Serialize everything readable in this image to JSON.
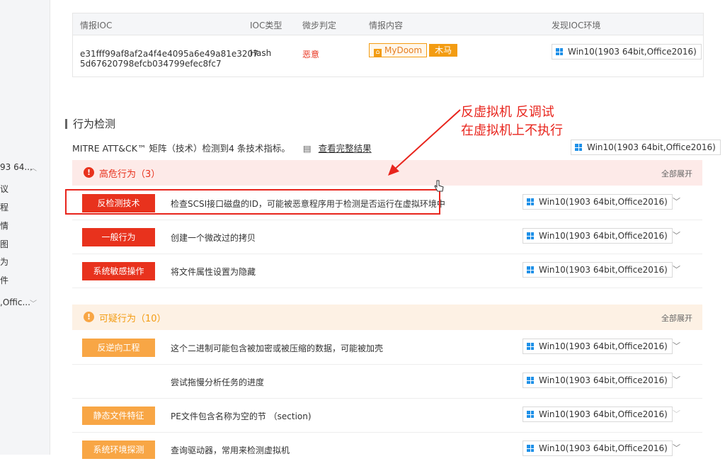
{
  "left_sidebar": {
    "items": [
      "93 64...",
      "议",
      "程",
      "情",
      "图",
      "为",
      "件",
      ",Offic..."
    ]
  },
  "intel_ioc": {
    "headers": [
      "情报IOC",
      "IOC类型",
      "微步判定",
      "情报内容",
      "发现IOC环境"
    ],
    "row": {
      "ioc_line1": "e31fff99af8af2a4f4e4095a6e49a81e3207",
      "ioc_line2": "5d67620798efcb034799efec8fc7",
      "type": "Hash",
      "verdict": "恶意",
      "tag1": "MyDoom",
      "tag2": "木马",
      "env": "Win10(1903 64bit,Office2016)"
    }
  },
  "behavior": {
    "title": "行为检测",
    "mitre_text": "MITRE ATT&CK™ 矩阵（技术）检测到4 条技术指标。",
    "mitre_link": "查看完整结果",
    "env": "Win10(1903 64bit,Office2016)",
    "high_group": {
      "label": "高危行为（3）",
      "expand": "全部展开"
    },
    "high_rows": [
      {
        "tag": "反检测技术",
        "desc": "检查SCSI接口磁盘的ID，可能被恶意程序用于检测是否运行在虚拟环境中",
        "env": "Win10(1903 64bit,Office2016)"
      },
      {
        "tag": "一般行为",
        "desc": "创建一个微改过的拷贝",
        "env": "Win10(1903 64bit,Office2016)"
      },
      {
        "tag": "系统敏感操作",
        "desc": "将文件属性设置为隐藏",
        "env": "Win10(1903 64bit,Office2016)"
      }
    ],
    "sus_group": {
      "label": "可疑行为（10）",
      "expand": "全部展开"
    },
    "sus_rows": [
      {
        "tag": "反逆向工程",
        "desc": "这个二进制可能包含被加密或被压缩的数据，可能被加壳",
        "env": "Win10(1903 64bit,Office2016)"
      },
      {
        "tag": "",
        "desc": "尝试拖慢分析任务的进度",
        "env": "Win10(1903 64bit,Office2016)"
      },
      {
        "tag": "静态文件特征",
        "desc": "PE文件包含名称为空的节 （section)",
        "env": "Win10(1903 64bit,Office2016)"
      },
      {
        "tag": "系统环境探测",
        "desc": "查询驱动器，常用来检测虚拟机",
        "env": "Win10(1903 64bit,Office2016)"
      }
    ]
  },
  "annotation": {
    "line1": "反虚拟机 反调试",
    "line2": "在虚拟机上不执行"
  },
  "colors": {
    "danger": "#e8321d",
    "warning": "#f8a645",
    "annotation": "#e8241c",
    "windows_blue": "#1e90e8"
  }
}
